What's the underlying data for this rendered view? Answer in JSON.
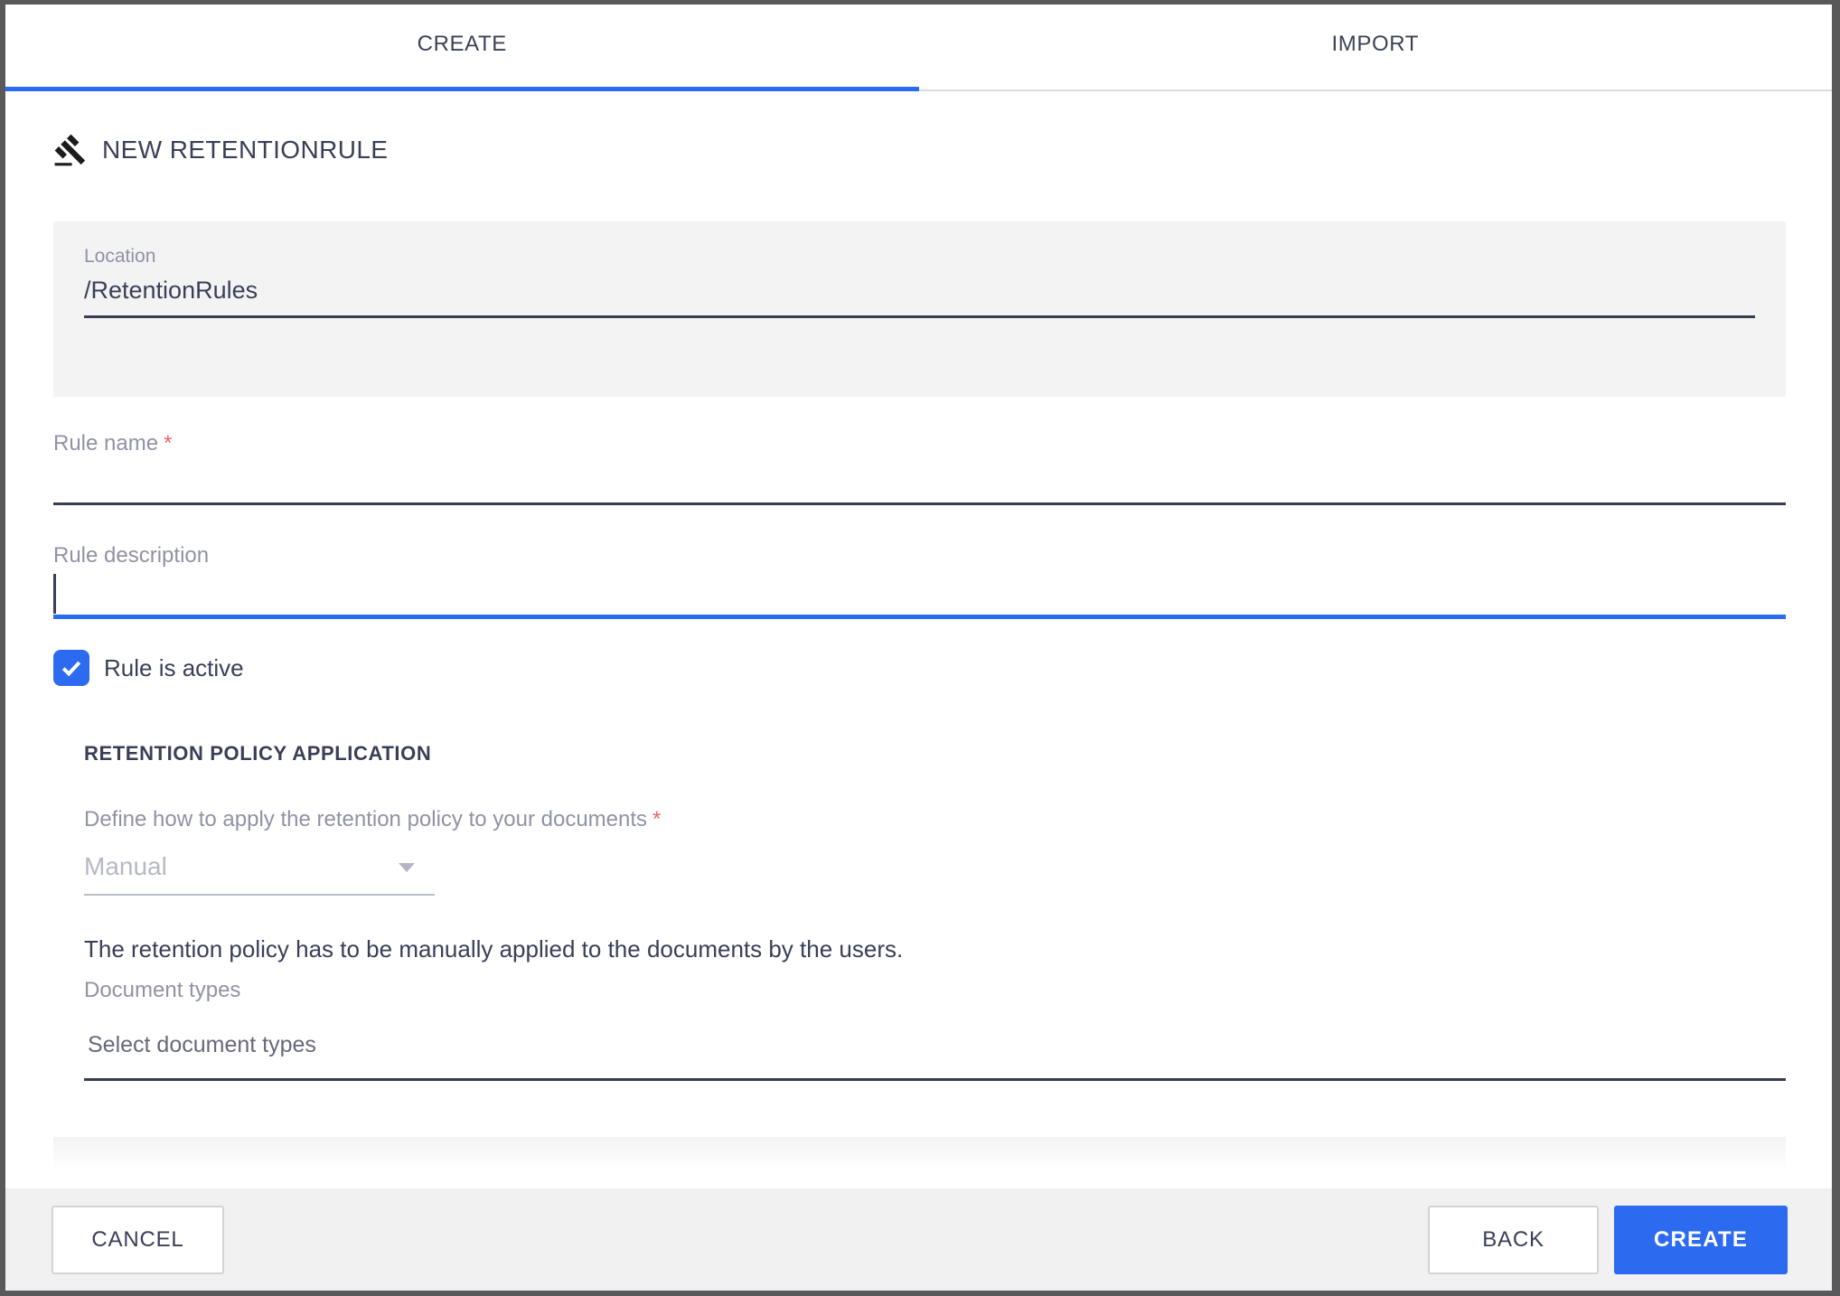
{
  "tabs": {
    "create": "CREATE",
    "import": "IMPORT",
    "active": "create"
  },
  "header": {
    "title": "NEW RETENTIONRULE",
    "icon": "gavel-icon"
  },
  "form": {
    "location": {
      "label": "Location",
      "value": "/RetentionRules"
    },
    "rule_name": {
      "label": "Rule name",
      "required_marker": "*",
      "value": ""
    },
    "rule_description": {
      "label": "Rule description",
      "value": ""
    },
    "rule_active": {
      "label": "Rule is active",
      "checked": true
    },
    "retention_policy": {
      "section_title": "RETENTION POLICY APPLICATION",
      "apply_label": "Define how to apply the retention policy to your documents",
      "required_marker": "*",
      "apply_value": "Manual",
      "apply_help": "The retention policy has to be manually applied to the documents by the users.",
      "document_types_label": "Document types",
      "document_types_placeholder": "Select document types"
    }
  },
  "footer": {
    "cancel": "CANCEL",
    "back": "BACK",
    "create": "CREATE"
  },
  "colors": {
    "accent_blue": "#2c6bf0",
    "required_red": "#ef6666",
    "dark_text": "#3a3f58",
    "label_gray": "#8f93a5",
    "disabled_gray": "#b6b9c6",
    "footer_bg": "#f1f1f2",
    "box_bg": "#f3f3f4"
  }
}
